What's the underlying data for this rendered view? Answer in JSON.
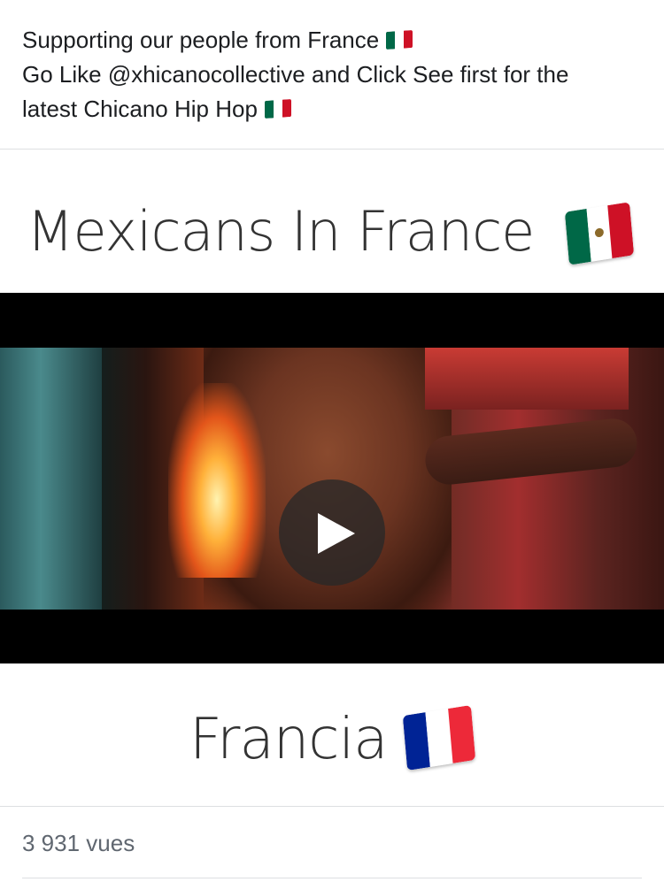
{
  "post": {
    "lines": [
      "Supporting our people from France",
      "Go Like @xhicanocollective and Click See first for the",
      "latest Chicano Hip Hop"
    ]
  },
  "video": {
    "top_title": "Mexicans In France",
    "bottom_title": "Francia",
    "play_icon": "play-icon"
  },
  "footer": {
    "views": "3 931 vues"
  },
  "colors": {
    "mexico_green": "#006847",
    "mexico_red": "#ce1126",
    "france_blue": "#002395",
    "france_red": "#ed2939"
  }
}
